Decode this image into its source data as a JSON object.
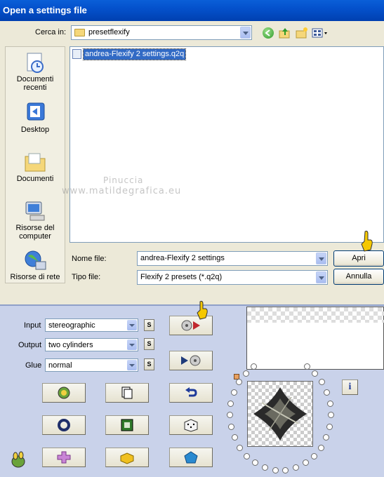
{
  "window": {
    "title": "Open a settings file"
  },
  "lookin": {
    "label": "Cerca in:",
    "folder": "presetflexify"
  },
  "places": [
    {
      "label": "Documenti recenti"
    },
    {
      "label": "Desktop"
    },
    {
      "label": "Documenti"
    },
    {
      "label": "Risorse del computer"
    },
    {
      "label": "Risorse di rete"
    }
  ],
  "files": [
    {
      "name": "andrea-Flexify 2 settings.q2q"
    }
  ],
  "watermark": {
    "line1": "Pinuccia",
    "line2": "www.matildegrafica.eu"
  },
  "filename": {
    "label": "Nome file:",
    "value": "andrea-Flexify 2 settings"
  },
  "filetype": {
    "label": "Tipo file:",
    "value": "Flexify 2 presets (*.q2q)"
  },
  "buttons": {
    "open": "Apri",
    "cancel": "Annulla"
  },
  "panel": {
    "input": {
      "label": "Input",
      "value": "stereographic"
    },
    "output": {
      "label": "Output",
      "value": "two cylinders"
    },
    "glue": {
      "label": "Glue",
      "value": "normal"
    },
    "s_label": "S",
    "info_label": "i"
  },
  "colors": {
    "titlebar": "#0451cc",
    "panel": "#c9d2ea",
    "accent": "#316ac5",
    "pointer": "#f5c800"
  }
}
